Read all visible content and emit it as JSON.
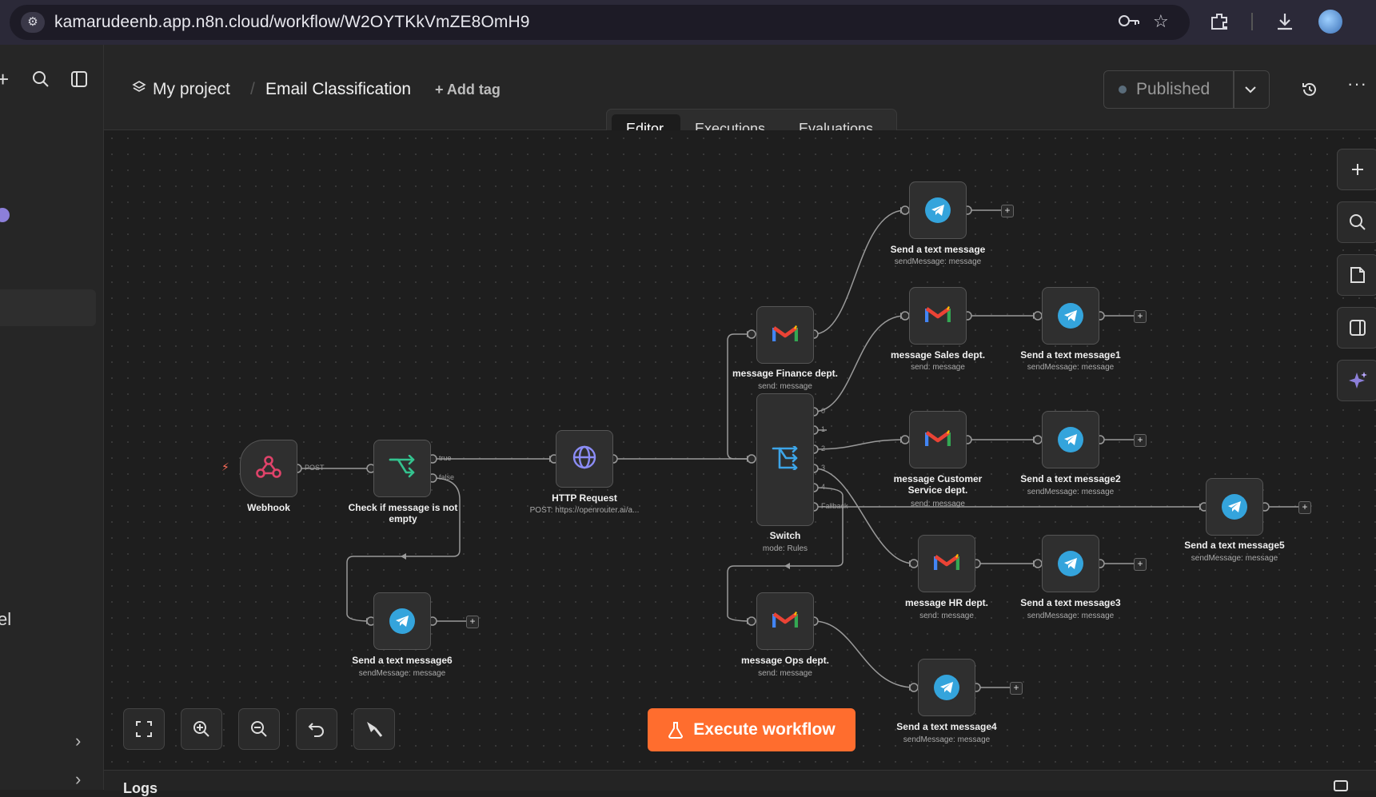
{
  "browser": {
    "url": "kamarudeenb.app.n8n.cloud/workflow/W2OYTKkVmZE8OmH9"
  },
  "header": {
    "project": "My project",
    "separator": "/",
    "workflow_name": "Email Classification",
    "add_tag": "+ Add tag",
    "status": "Published"
  },
  "tabs": [
    {
      "label": "Editor",
      "active": true
    },
    {
      "label": "Executions",
      "active": false
    },
    {
      "label": "Evaluations",
      "active": false
    }
  ],
  "nodes": {
    "webhook": {
      "title": "Webhook",
      "sub": ""
    },
    "check": {
      "title": "Check if message is not empty",
      "sub": ""
    },
    "http": {
      "title": "HTTP Request",
      "sub": "POST: https://openrouter.ai/a..."
    },
    "switch": {
      "title": "Switch",
      "sub": "mode: Rules"
    },
    "finance": {
      "title": "message Finance dept.",
      "sub": "send: message"
    },
    "sales": {
      "title": "message Sales dept.",
      "sub": "send: message"
    },
    "cs": {
      "title": "message Customer Service dept.",
      "sub": "send: message"
    },
    "hr": {
      "title": "message HR dept.",
      "sub": "send: message"
    },
    "ops": {
      "title": "message Ops dept.",
      "sub": "send: message"
    },
    "tg0": {
      "title": "Send a text message",
      "sub": "sendMessage: message"
    },
    "tg1": {
      "title": "Send a text message1",
      "sub": "sendMessage: message"
    },
    "tg2": {
      "title": "Send a text message2",
      "sub": "sendMessage: message"
    },
    "tg3": {
      "title": "Send a text message3",
      "sub": "sendMessage: message"
    },
    "tg4": {
      "title": "Send a text message4",
      "sub": "sendMessage: message"
    },
    "tg5": {
      "title": "Send a text message5",
      "sub": "sendMessage: message"
    },
    "tg6": {
      "title": "Send a text message6",
      "sub": "sendMessage: message"
    }
  },
  "port_labels": {
    "post": "POST",
    "true": "true",
    "false": "false",
    "o0": "0",
    "o1": "1",
    "o2": "2",
    "o3": "3",
    "o4": "4",
    "fallback": "Fallback"
  },
  "execute_button": "Execute workflow",
  "logs_label": "Logs",
  "sidebar_fragment": "el",
  "colors": {
    "execute": "#ff6d2e",
    "accent": "#ff6d5a",
    "telegram": "#34a4dc",
    "http_icon": "#8b8cf5",
    "switch_icon": "#3da5e8",
    "filter_icon": "#34c38f",
    "webhook_icon": "#e0436a"
  }
}
